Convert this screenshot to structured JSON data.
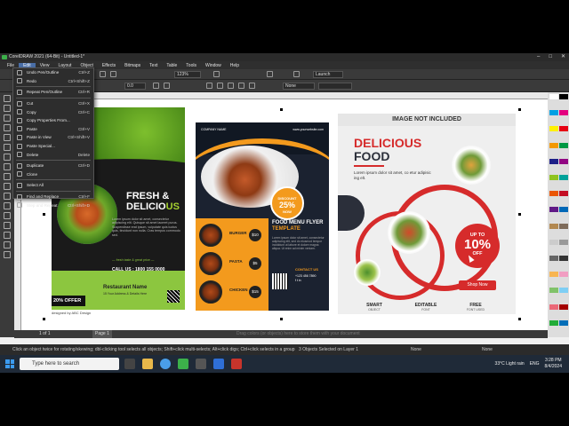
{
  "app": {
    "title": "CorelDRAW 2021 (64-Bit) - Untitled-1*",
    "window_controls": [
      "–",
      "□",
      "✕"
    ]
  },
  "menubar": [
    "File",
    "Edit",
    "View",
    "Layout",
    "Object",
    "Effects",
    "Bitmaps",
    "Text",
    "Table",
    "Tools",
    "Window",
    "Help"
  ],
  "toolbar": {
    "zoom": "123%",
    "rotation": "0.0",
    "launch": "Launch",
    "outline_none": "None"
  },
  "edit_menu": {
    "items": [
      {
        "label": "Undo Pen/Outline",
        "shortcut": "Ctrl+Z"
      },
      {
        "label": "Redo",
        "shortcut": "Ctrl+Shift+Z"
      },
      {
        "sep": true
      },
      {
        "label": "Repeat Pen/Outline",
        "shortcut": "Ctrl+R"
      },
      {
        "sep": true
      },
      {
        "label": "Cut",
        "shortcut": "Ctrl+X"
      },
      {
        "label": "Copy",
        "shortcut": "Ctrl+C"
      },
      {
        "label": "Copy Properties From...",
        "shortcut": ""
      },
      {
        "label": "Paste",
        "shortcut": "Ctrl+V"
      },
      {
        "label": "Paste in View",
        "shortcut": "Ctrl+Shift+V"
      },
      {
        "label": "Paste Special...",
        "shortcut": ""
      },
      {
        "label": "Delete",
        "shortcut": "Delete"
      },
      {
        "sep": true
      },
      {
        "label": "Duplicate",
        "shortcut": "Ctrl+D"
      },
      {
        "label": "Clone",
        "shortcut": ""
      },
      {
        "sep": true
      },
      {
        "label": "Select All",
        "shortcut": ""
      },
      {
        "sep": true
      },
      {
        "label": "Find and Replace",
        "shortcut": "Ctrl+F"
      },
      {
        "label": "Step and Repeat",
        "shortcut": "Ctrl+Shift+D"
      }
    ]
  },
  "flyer1": {
    "title_line1": "FRESH &",
    "title_line2a": "DELICIO",
    "title_line2b": "US",
    "lorem": "Lorem ipsum dolor sit amet, consectetur adipiscing elit. Quisque sit amet laoreet purus. Suspendisse erat ipsum, vulputate quis luctus quis, tincidunt non nulla. Cras tempus commodo sed.",
    "tagline": "— fresh taste & great price —",
    "call": "CALL US : 1800 155 0000",
    "offer": "20% OFFER",
    "restaurant": "Restaurant Name",
    "address": "15 Your Address & Details Here",
    "footer": "designed by  ABC Design"
  },
  "flyer2": {
    "company": "COMPANY NAME",
    "url": "www.yourwebsite.com",
    "badge_top": "DISCOUNT",
    "badge_value": "25%",
    "badge_bottom": "NOW",
    "items": [
      {
        "label": "BURGER",
        "price": "$10"
      },
      {
        "label": "PASTA",
        "price": "$5"
      },
      {
        "label": "CHICKEN",
        "price": "$15"
      }
    ],
    "menu_title_a": "FOOD MENU FLYER",
    "menu_title_b": "TEMPLATE",
    "lorem": "Lorem ipsum dolor sit amet, consectetur adipiscing elit, sed do eiusmod tempor incididunt ut labore et dolore magna aliqua. Ut enim ad minim veniam.",
    "contact_title": "CONTACT US",
    "phone": "+123 456 7890",
    "social": "f  t  in"
  },
  "flyer3": {
    "banner": "IMAGE NOT INCLUDED",
    "title_line1": "DELICIOUS",
    "title_line2": "FOOD",
    "lorem": "Lorem ipsum dolor sit amet, co etur adipisic ing elt.",
    "circle_top": "UP TO",
    "circle_value": "10%",
    "circle_bottom": "OFF",
    "shop": "Shop Now",
    "features": [
      {
        "title": "SMART",
        "sub": "OBJECT"
      },
      {
        "title": "EDITABLE",
        "sub": "FONT"
      },
      {
        "title": "FREE",
        "sub": "FONT USED"
      }
    ]
  },
  "pagebar": {
    "page_info": "1 of 1",
    "page_tab": "Page 1",
    "hint": "Drag colors (or objects) here to store them with your document"
  },
  "statusbar": {
    "hint": "Click an object twice for rotating/skewing; dbl-clicking tool selects all objects; Shift+click multi-selects; Alt+click digs; Ctrl+click selects in a group",
    "selection": "3 Objects Selected on Layer 1",
    "fill": "None",
    "outline": "None"
  },
  "taskbar": {
    "search_placeholder": "Type here to search",
    "weather": "33°C  Light rain",
    "lang": "ENG",
    "time": "3:28 PM",
    "date": "8/4/2024"
  },
  "colors": {
    "accent_red": "#d62b2b",
    "accent_orange": "#f39a1d",
    "accent_green": "#8cc63f"
  }
}
